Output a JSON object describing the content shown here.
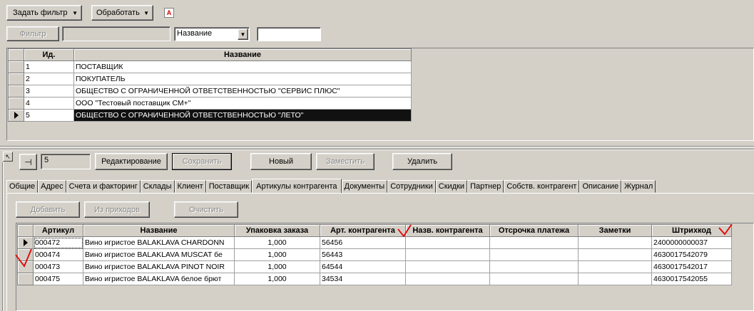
{
  "toolbar": {
    "set_filter": "Задать фильтр",
    "process": "Обработать",
    "red_icon_letter": "A"
  },
  "filter": {
    "button": "Фильтр",
    "field_value": "",
    "select_value": "Название",
    "search_value": ""
  },
  "top_table": {
    "columns": [
      "Ид.",
      "Название"
    ],
    "rows": [
      {
        "id": "1",
        "name": "ПОСТАВЩИК"
      },
      {
        "id": "2",
        "name": "ПОКУПАТЕЛЬ"
      },
      {
        "id": "3",
        "name": "ОБЩЕСТВО С ОГРАНИЧЕННОЙ ОТВЕТСТВЕННОСТЬЮ \"СЕРВИС ПЛЮС\""
      },
      {
        "id": "4",
        "name": "ООО \"Тестовый поставщик СМ+\""
      },
      {
        "id": "5",
        "name": "ОБЩЕСТВО С ОГРАНИЧЕННОЙ ОТВЕТСТВЕННОСТЬЮ \"ЛЕТО\""
      }
    ],
    "selected_row": 5
  },
  "record_bar": {
    "id_value": "5",
    "edit": "Редактирование",
    "save": "Сохранить",
    "new": "Новый",
    "replace": "Заместить",
    "delete": "Удалить"
  },
  "tabs": [
    {
      "label": "Общие"
    },
    {
      "label": "Адрес"
    },
    {
      "label": "Счета и факторинг"
    },
    {
      "label": "Склады"
    },
    {
      "label": "Клиент"
    },
    {
      "label": "Поставщик"
    },
    {
      "label": "Артикулы контрагента",
      "active": true
    },
    {
      "label": "Документы"
    },
    {
      "label": "Сотрудники"
    },
    {
      "label": "Скидки"
    },
    {
      "label": "Партнер"
    },
    {
      "label": "Собств. контрагент"
    },
    {
      "label": "Описание"
    },
    {
      "label": "Журнал"
    }
  ],
  "article_actions": {
    "add": "Добавить",
    "from_receipts": "Из приходов",
    "clear": "Очистить"
  },
  "articles_table": {
    "columns": [
      "Артикул",
      "Название",
      "Упаковка заказа",
      "Арт. контрагента",
      "Назв. контрагента",
      "Отсрочка платежа",
      "Заметки",
      "Штрихкод"
    ],
    "rows": [
      {
        "article": "000472",
        "name": "Вино игристое BALAKLAVA CHARDONN",
        "pack": "1,000",
        "partner_art": "56456",
        "partner_name": "",
        "delay": "",
        "notes": "",
        "barcode": "2400000000037"
      },
      {
        "article": "000474",
        "name": "Вино игристое BALAKLAVA MUSCAT бе",
        "pack": "1,000",
        "partner_art": "56443",
        "partner_name": "",
        "delay": "",
        "notes": "",
        "barcode": "4630017542079"
      },
      {
        "article": "000473",
        "name": "Вино игристое BALAKLAVA PINOT NOIR",
        "pack": "1,000",
        "partner_art": "64544",
        "partner_name": "",
        "delay": "",
        "notes": "",
        "barcode": "4630017542017"
      },
      {
        "article": "000475",
        "name": "Вино игристое BALAKLAVA белое брют",
        "pack": "1,000",
        "partner_art": "34534",
        "partner_name": "",
        "delay": "",
        "notes": "",
        "barcode": "4630017542055"
      }
    ],
    "current_row": 1
  },
  "colors": {
    "window_bg": "#d4d0c8",
    "selection_bg": "#111111",
    "annotation_red": "#e00000"
  }
}
